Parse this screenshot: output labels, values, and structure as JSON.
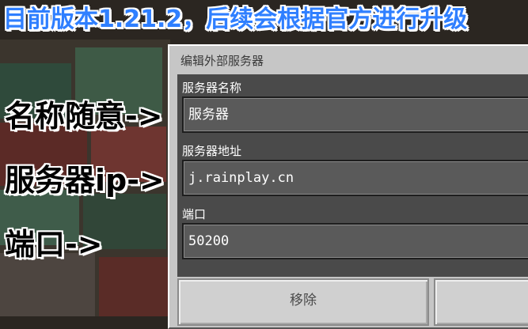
{
  "banner": {
    "text": "目前版本1.21.2，后续会根据官方进行升级"
  },
  "annotations": {
    "name": "名称随意->",
    "ip": "服务器ip->",
    "port": "端口->"
  },
  "dialog": {
    "title": "编辑外部服务器",
    "fields": [
      {
        "label": "服务器名称",
        "value": "服务器"
      },
      {
        "label": "服务器地址",
        "value": "j.rainplay.cn"
      },
      {
        "label": "端口",
        "value": "50200"
      }
    ],
    "buttons": {
      "remove": "移除",
      "save": ""
    }
  },
  "colors": {
    "banner_text": "#2f7fff",
    "dialog_bg": "#c6c6c6",
    "form_bg": "#4a4a4a",
    "input_bg": "#5a5a5a"
  }
}
